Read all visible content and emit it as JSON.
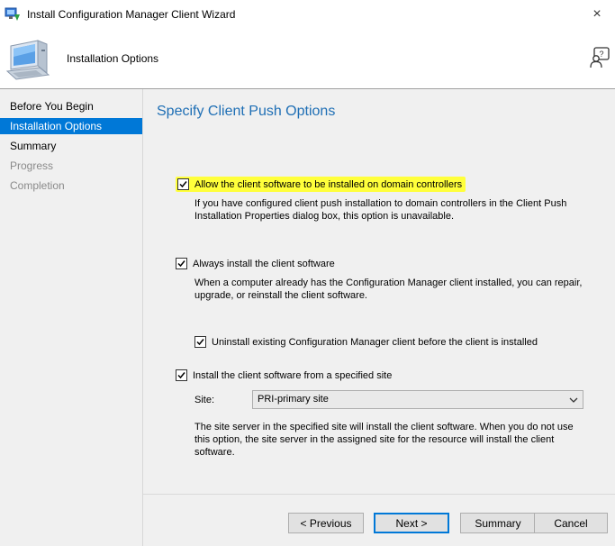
{
  "window": {
    "title": "Install Configuration Manager Client Wizard",
    "close_glyph": "×",
    "icon": "wizard-app-icon"
  },
  "header": {
    "title": "Installation Options",
    "icon": "computer-icon",
    "help_icon": "user-help-icon"
  },
  "sidebar": {
    "items": [
      {
        "label": "Before You Begin",
        "state": "normal"
      },
      {
        "label": "Installation Options",
        "state": "active"
      },
      {
        "label": "Summary",
        "state": "normal"
      },
      {
        "label": "Progress",
        "state": "disabled"
      },
      {
        "label": "Completion",
        "state": "disabled"
      }
    ]
  },
  "main": {
    "title": "Specify Client Push Options",
    "options": {
      "domain_controllers": {
        "label": "Allow the client software to be installed on domain controllers",
        "checked": true,
        "highlight_color": "#ffff3b",
        "description": "If you have configured client push installation to domain controllers in the Client Push Installation Properties dialog box, this option is unavailable."
      },
      "always_install": {
        "label": "Always install the client software",
        "checked": true,
        "description": "When a computer already has the Configuration Manager client installed, you can repair, upgrade, or reinstall the client software."
      },
      "uninstall_existing": {
        "label": "Uninstall existing Configuration Manager client before the client is installed",
        "checked": true
      },
      "specified_site": {
        "label": "Install the client software from a specified site",
        "checked": true,
        "site_label": "Site:",
        "site_value": "PRI-primary site",
        "description": "The site server in the specified site will install the client software.  When you do not use this option, the site server in the assigned site for the resource will install the client software."
      }
    }
  },
  "buttons": {
    "previous": "< Previous",
    "next": "Next >",
    "summary": "Summary",
    "cancel": "Cancel"
  },
  "colors": {
    "accent": "#0078d7",
    "title_blue": "#1f6fb5",
    "panel_bg": "#f0f0f0"
  }
}
